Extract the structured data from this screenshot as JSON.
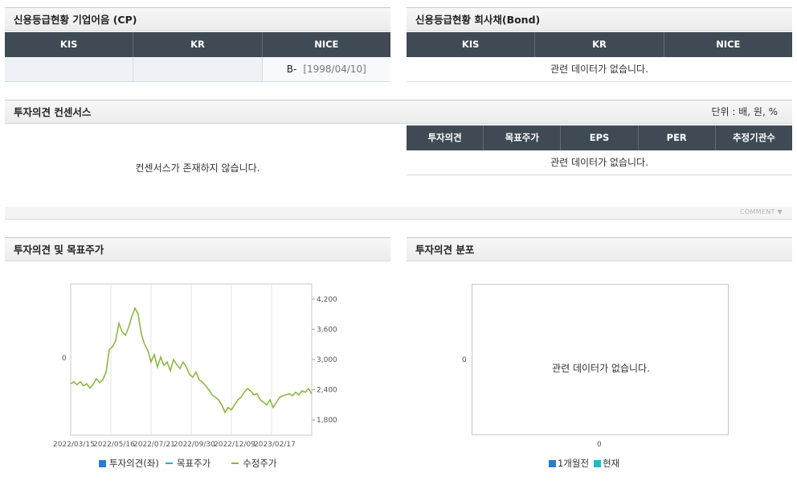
{
  "credit_cp": {
    "title": "신용등급현황 기업어음 (CP)",
    "headers": [
      "KIS",
      "KR",
      "NICE"
    ],
    "row": {
      "kis": "",
      "kr": "",
      "nice_grade": "B-",
      "nice_date": "[1998/04/10]"
    }
  },
  "credit_bond": {
    "title": "신용등급현황 회사채(Bond)",
    "headers": [
      "KIS",
      "KR",
      "NICE"
    ],
    "empty": "관련 데이터가 없습니다."
  },
  "consensus": {
    "title": "투자의견 컨센서스",
    "unit": "단위 : 배, 원, %",
    "left_empty": "컨센서스가 존재하지 않습니다.",
    "headers": [
      "투자의견",
      "목표주가",
      "EPS",
      "PER",
      "추정기관수"
    ],
    "empty": "관련 데이터가 없습니다."
  },
  "comment_label": "COMMENT ▼",
  "chart_opinion": {
    "title": "투자의견 및 목표주가",
    "left_tick": "0",
    "legend": {
      "opinion": "투자의견(좌)",
      "target": "목표주가",
      "price": "수정주가"
    },
    "colors": {
      "opinion": "#2a7bd6",
      "target": "#2aa7d6",
      "price": "#8db843"
    }
  },
  "chart_distribution": {
    "title": "투자의견 분포",
    "y_tick": "0",
    "x_tick": "0",
    "empty": "관련 데이터가 없습니다.",
    "legend": {
      "prev": "1개월전",
      "now": "현재"
    },
    "colors": {
      "prev": "#2a7bd6",
      "now": "#22b8c8"
    }
  },
  "chart_data": {
    "type": "line",
    "x_ticks": [
      "2022/03/15",
      "2022/05/16",
      "2022/07/21",
      "2022/09/30",
      "2022/12/09",
      "2023/02/17"
    ],
    "y_ticks_right": [
      "4,200",
      "3,600",
      "3,000",
      "2,400",
      "1,800"
    ],
    "ylim_right": [
      1500,
      4500
    ],
    "left_ticks": [
      "0"
    ],
    "grid": true,
    "legend_position": "bottom",
    "series": [
      {
        "name": "투자의견(좌)",
        "values": []
      },
      {
        "name": "목표주가",
        "values": []
      },
      {
        "name": "수정주가",
        "values": [
          2520,
          2560,
          2500,
          2560,
          2480,
          2520,
          2430,
          2510,
          2620,
          2540,
          2600,
          2750,
          3200,
          3250,
          3380,
          3720,
          3550,
          3480,
          3630,
          3850,
          4020,
          3900,
          3500,
          3300,
          3180,
          2950,
          3100,
          2850,
          3050,
          2880,
          2950,
          2780,
          3000,
          2900,
          2820,
          2950,
          2850,
          2700,
          2650,
          2750,
          2600,
          2550,
          2480,
          2400,
          2300,
          2250,
          2200,
          2100,
          1950,
          2050,
          2000,
          2100,
          2200,
          2250,
          2350,
          2420,
          2380,
          2300,
          2320,
          2200,
          2150,
          2100,
          2200,
          2050,
          2150,
          2250,
          2280,
          2300,
          2320,
          2280,
          2350,
          2300,
          2380,
          2350,
          2420,
          2320
        ]
      }
    ]
  }
}
